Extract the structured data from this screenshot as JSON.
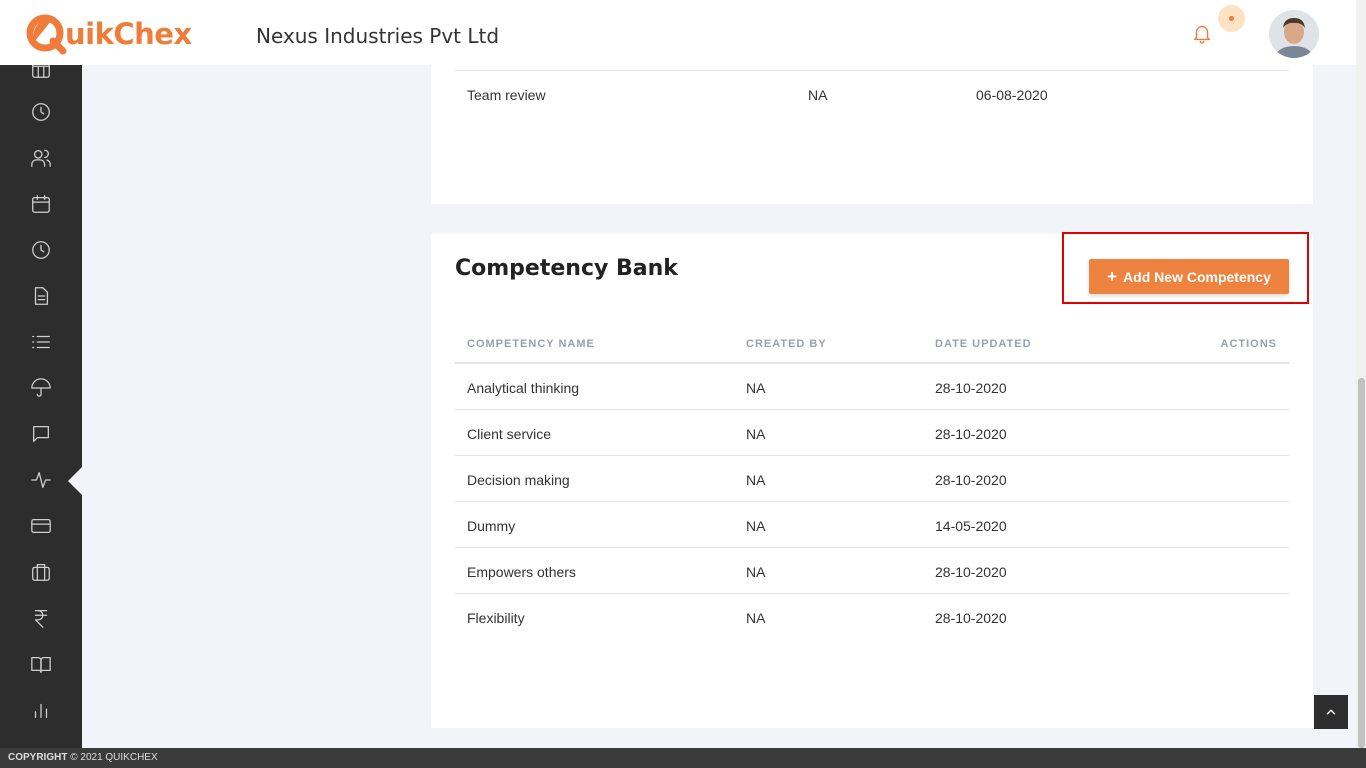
{
  "header": {
    "logo_text": "uikChex",
    "company_name": "Nexus Industries Pvt Ltd"
  },
  "sidebar": {
    "items": [
      {
        "icon": "grid-icon"
      },
      {
        "icon": "clock-icon"
      },
      {
        "icon": "users-icon"
      },
      {
        "icon": "calendar-icon"
      },
      {
        "icon": "clock-icon"
      },
      {
        "icon": "document-icon"
      },
      {
        "icon": "list-icon"
      },
      {
        "icon": "umbrella-icon"
      },
      {
        "icon": "chat-icon"
      },
      {
        "icon": "activity-icon",
        "active": true
      },
      {
        "icon": "credit-card-icon"
      },
      {
        "icon": "briefcase-icon"
      },
      {
        "icon": "rupee-icon"
      },
      {
        "icon": "book-icon"
      },
      {
        "icon": "bar-chart-icon"
      }
    ]
  },
  "previous_table": {
    "last_row": {
      "name": "Team review",
      "created_by": "NA",
      "date": "06-08-2020"
    }
  },
  "competency_bank": {
    "title": "Competency Bank",
    "add_button_label": "Add New Competency",
    "columns": [
      "COMPETENCY NAME",
      "CREATED BY",
      "DATE UPDATED",
      "ACTIONS"
    ],
    "rows": [
      {
        "name": "Analytical thinking",
        "created_by": "NA",
        "date": "28-10-2020"
      },
      {
        "name": "Client service",
        "created_by": "NA",
        "date": "28-10-2020"
      },
      {
        "name": "Decision making",
        "created_by": "NA",
        "date": "28-10-2020"
      },
      {
        "name": "Dummy",
        "created_by": "NA",
        "date": "14-05-2020"
      },
      {
        "name": "Empowers others",
        "created_by": "NA",
        "date": "28-10-2020"
      },
      {
        "name": "Flexibility",
        "created_by": "NA",
        "date": "28-10-2020"
      }
    ]
  },
  "footer": {
    "copyright_label": "COPYRIGHT",
    "copyright_text": "© 2021 QUIKCHEX"
  },
  "colors": {
    "brand_orange": "#ee7c3b",
    "sidebar_bg": "#2d2d2d",
    "highlight": "#e00000"
  }
}
